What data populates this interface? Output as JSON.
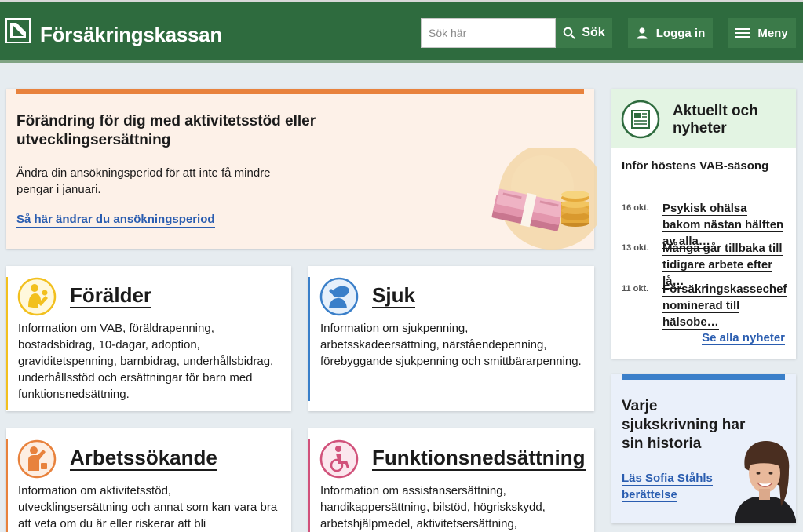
{
  "header": {
    "brand": "Försäkringskassan",
    "search_placeholder": "Sök här",
    "search_label": "Sök",
    "login_label": "Logga in",
    "menu_label": "Meny"
  },
  "hero": {
    "title": "Förändring för dig med aktivitetsstöd eller utvecklingsersättning",
    "text": "Ändra din ansökningsperiod för att inte få mindre pengar i januari.",
    "link": "Så här ändrar du ansökningsperiod"
  },
  "cards": [
    {
      "title": "Förälder",
      "text": "Information om VAB, föräldrapenning, bostadsbidrag, 10-dagar, adoption, graviditetspenning, barnbidrag, underhållsbidrag, underhållsstöd och ersättningar för barn med funktionsnedsättning.",
      "color": "#f2c01e"
    },
    {
      "title": "Sjuk",
      "text": "Information om sjukpenning, arbetsskadeersättning, närståendepenning, förebyggande sjukpenning och smittbärarpenning.",
      "color": "#3a7fc9"
    },
    {
      "title": "Arbetssökande",
      "text": "Information om aktivitetsstöd, utvecklingsersättning och annat som kan vara bra att veta om du är eller riskerar att bli arbetssökande.",
      "color": "#e8823d"
    },
    {
      "title": "Funktionsnedsättning",
      "text": "Information om assistansersättning, handikappersättning, bilstöd, högriskskydd, arbetshjälpmedel, aktivitetsersättning,",
      "color": "#d1527b"
    }
  ],
  "news": {
    "title": "Aktuellt och nyheter",
    "featured": "Inför höstens VAB-säsong",
    "items": [
      {
        "date": "16 okt.",
        "title": "Psykisk ohälsa bakom nästan hälften av alla…"
      },
      {
        "date": "13 okt.",
        "title": "Många går tillbaka till tidigare arbete efter lå…"
      },
      {
        "date": "11 okt.",
        "title": "Försäkringskassechef nominerad till hälsobe…"
      }
    ],
    "all_link": "Se alla nyheter"
  },
  "promo": {
    "title": "Varje sjukskrivning har sin historia",
    "link": "Läs Sofia Ståhls berättelse"
  },
  "colors": {
    "header_green": "#2e6b3e",
    "button_green": "#3b7a49",
    "link_blue": "#2a5db0",
    "hero_orange": "#e8823d",
    "news_green": "#2e6b3e"
  }
}
